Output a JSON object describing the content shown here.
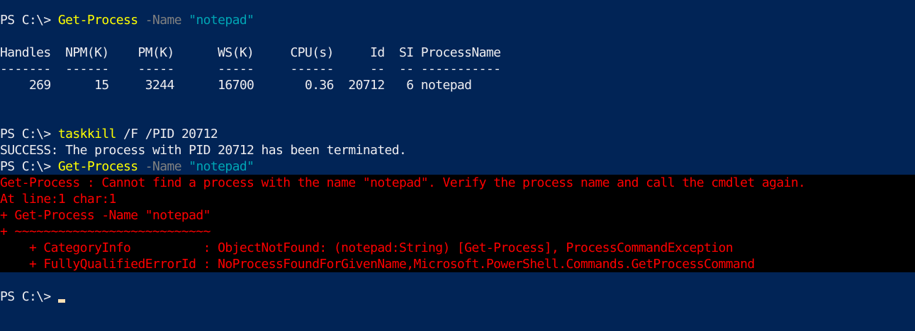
{
  "prompt": "PS C:\\> ",
  "cmd1": {
    "cmdlet": "Get-Process",
    "param": "-Name",
    "arg": "\"notepad\""
  },
  "table": {
    "headers": "Handles  NPM(K)    PM(K)      WS(K)     CPU(s)     Id  SI ProcessName",
    "divider": "-------  ------    -----      -----     ------     --  -- -----------",
    "row": "    269      15     3244      16700       0.36  20712   6 notepad"
  },
  "cmd2": {
    "cmdlet": "taskkill",
    "args": " /F /PID 20712"
  },
  "success": "SUCCESS: The process with PID 20712 has been terminated.",
  "cmd3": {
    "cmdlet": "Get-Process",
    "param": "-Name",
    "arg": "\"notepad\""
  },
  "error": {
    "line1": "Get-Process : Cannot find a process with the name \"notepad\". Verify the process name and call the cmdlet again.",
    "line2": "At line:1 char:1",
    "line3": "+ Get-Process -Name \"notepad\"",
    "line4": "+ ~~~~~~~~~~~~~~~~~~~~~~~~~~~",
    "line5": "    + CategoryInfo          : ObjectNotFound: (notepad:String) [Get-Process], ProcessCommandException",
    "line6": "    + FullyQualifiedErrorId : NoProcessFoundForGivenName,Microsoft.PowerShell.Commands.GetProcessCommand"
  },
  "colors": {
    "background": "#012456",
    "cmdlet": "#ffff00",
    "parameter": "#808080",
    "string": "#00a5b4",
    "error": "#ff0000",
    "error_background": "#000000",
    "cursor": "#ffe1b4"
  }
}
